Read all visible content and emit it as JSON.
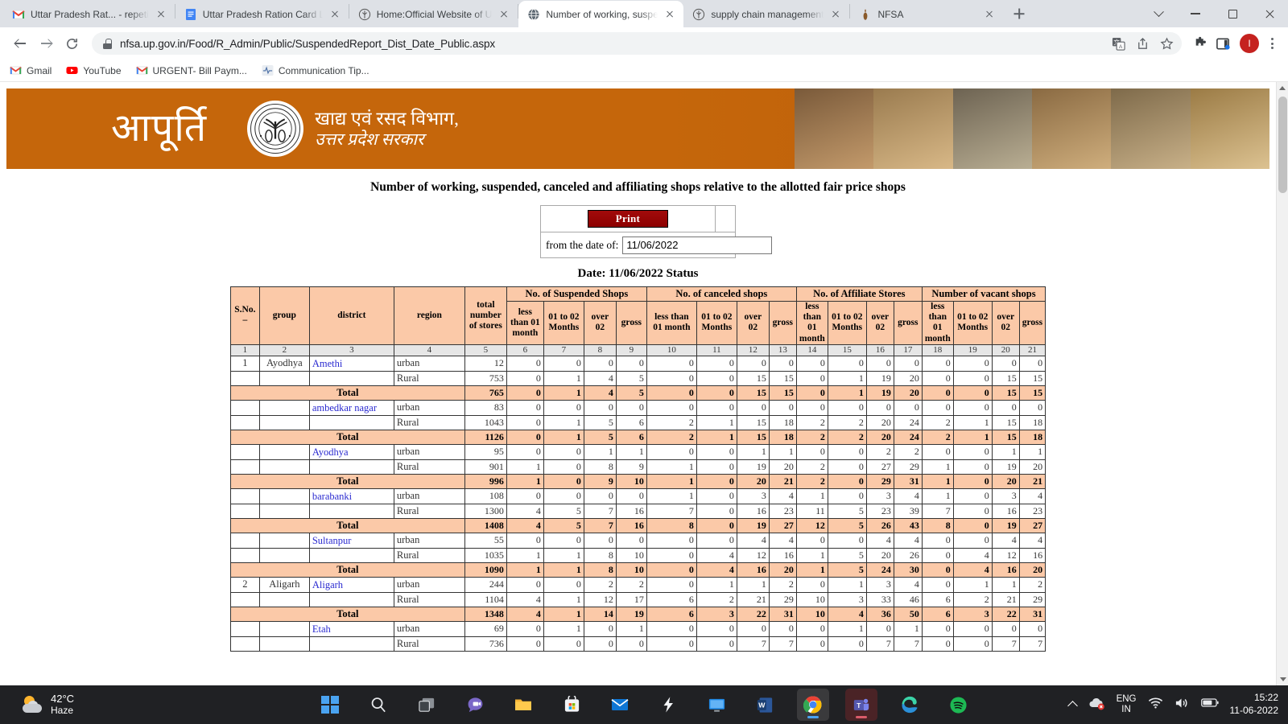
{
  "browser": {
    "tabs": [
      {
        "title": "Uttar Pradesh Rat... - repeti",
        "favicon": "gmail-icon",
        "active": false
      },
      {
        "title": "Uttar Pradesh Ration Card L",
        "favicon": "docs-icon",
        "active": false
      },
      {
        "title": "Home:Official Website of U",
        "favicon": "emblem-icon",
        "active": false
      },
      {
        "title": "Number of working, susper",
        "favicon": "globe-icon",
        "active": true
      },
      {
        "title": "supply chain management",
        "favicon": "emblem-icon",
        "active": false
      },
      {
        "title": "NFSA",
        "favicon": "emblem-icon",
        "active": false
      }
    ],
    "address": "nfsa.up.gov.in/Food/R_Admin/Public/SuspendedReport_Dist_Date_Public.aspx",
    "profile_initial": "I",
    "bookmarks": [
      {
        "label": "Gmail",
        "icon": "gmail-icon"
      },
      {
        "label": "YouTube",
        "icon": "youtube-icon"
      },
      {
        "label": "URGENT- Bill Paym...",
        "icon": "gmail-icon"
      },
      {
        "label": "Communication Tip...",
        "icon": "pulse-icon"
      }
    ]
  },
  "banner": {
    "brand": "आपूर्ति",
    "dept_line1": "खाद्य एवं रसद विभाग,",
    "dept_line2": "उत्तर प्रदेश सरकार"
  },
  "page": {
    "title": "Number of working, suspended, canceled and affiliating shops relative to the allotted fair price shops",
    "print_label": "Print",
    "date_field_label": "from the date of:",
    "date_value": "11/06/2022",
    "status_line": "Date: 11/06/2022 Status"
  },
  "table": {
    "group_headers": [
      {
        "label": "No. of Suspended Shops",
        "span": 4
      },
      {
        "label": "No. of canceled shops",
        "span": 4
      },
      {
        "label": "No. of Affiliate Stores",
        "span": 4
      },
      {
        "label": "Number of vacant shops",
        "span": 4
      }
    ],
    "lead_headers": [
      "S.No.\n–",
      "group",
      "district",
      "region",
      "total number of stores"
    ],
    "sub_headers": [
      "less than 01 month",
      "01 to 02 Months",
      "over 02",
      "gross"
    ],
    "column_numbers": [
      "1",
      "2",
      "3",
      "4",
      "5",
      "6",
      "7",
      "8",
      "9",
      "10",
      "11",
      "12",
      "13",
      "14",
      "15",
      "16",
      "17",
      "18",
      "19",
      "20",
      "21"
    ],
    "rows": [
      {
        "type": "data",
        "sno": "1",
        "group": "Ayodhya",
        "district": "Amethi",
        "region": "urban",
        "values": [
          12,
          0,
          0,
          0,
          0,
          0,
          0,
          0,
          0,
          0,
          0,
          0,
          0,
          0,
          0,
          0,
          0
        ]
      },
      {
        "type": "data",
        "sno": "",
        "group": "",
        "district": "",
        "region": "Rural",
        "values": [
          753,
          0,
          1,
          4,
          5,
          0,
          0,
          15,
          15,
          0,
          1,
          19,
          20,
          0,
          0,
          15,
          15
        ]
      },
      {
        "type": "total",
        "label": "Total",
        "values": [
          765,
          0,
          1,
          4,
          5,
          0,
          0,
          15,
          15,
          0,
          1,
          19,
          20,
          0,
          0,
          15,
          15
        ]
      },
      {
        "type": "data",
        "sno": "",
        "group": "",
        "district": "ambedkar nagar",
        "region": "urban",
        "values": [
          83,
          0,
          0,
          0,
          0,
          0,
          0,
          0,
          0,
          0,
          0,
          0,
          0,
          0,
          0,
          0,
          0
        ]
      },
      {
        "type": "data",
        "sno": "",
        "group": "",
        "district": "",
        "region": "Rural",
        "values": [
          1043,
          0,
          1,
          5,
          6,
          2,
          1,
          15,
          18,
          2,
          2,
          20,
          24,
          2,
          1,
          15,
          18
        ]
      },
      {
        "type": "total",
        "label": "Total",
        "values": [
          1126,
          0,
          1,
          5,
          6,
          2,
          1,
          15,
          18,
          2,
          2,
          20,
          24,
          2,
          1,
          15,
          18
        ]
      },
      {
        "type": "data",
        "sno": "",
        "group": "",
        "district": "Ayodhya",
        "region": "urban",
        "values": [
          95,
          0,
          0,
          1,
          1,
          0,
          0,
          1,
          1,
          0,
          0,
          2,
          2,
          0,
          0,
          1,
          1
        ]
      },
      {
        "type": "data",
        "sno": "",
        "group": "",
        "district": "",
        "region": "Rural",
        "values": [
          901,
          1,
          0,
          8,
          9,
          1,
          0,
          19,
          20,
          2,
          0,
          27,
          29,
          1,
          0,
          19,
          20
        ]
      },
      {
        "type": "total",
        "label": "Total",
        "values": [
          996,
          1,
          0,
          9,
          10,
          1,
          0,
          20,
          21,
          2,
          0,
          29,
          31,
          1,
          0,
          20,
          21
        ]
      },
      {
        "type": "data",
        "sno": "",
        "group": "",
        "district": "barabanki",
        "region": "urban",
        "values": [
          108,
          0,
          0,
          0,
          0,
          1,
          0,
          3,
          4,
          1,
          0,
          3,
          4,
          1,
          0,
          3,
          4
        ]
      },
      {
        "type": "data",
        "sno": "",
        "group": "",
        "district": "",
        "region": "Rural",
        "values": [
          1300,
          4,
          5,
          7,
          16,
          7,
          0,
          16,
          23,
          11,
          5,
          23,
          39,
          7,
          0,
          16,
          23
        ]
      },
      {
        "type": "total",
        "label": "Total",
        "values": [
          1408,
          4,
          5,
          7,
          16,
          8,
          0,
          19,
          27,
          12,
          5,
          26,
          43,
          8,
          0,
          19,
          27
        ]
      },
      {
        "type": "data",
        "sno": "",
        "group": "",
        "district": "Sultanpur",
        "region": "urban",
        "values": [
          55,
          0,
          0,
          0,
          0,
          0,
          0,
          4,
          4,
          0,
          0,
          4,
          4,
          0,
          0,
          4,
          4
        ]
      },
      {
        "type": "data",
        "sno": "",
        "group": "",
        "district": "",
        "region": "Rural",
        "values": [
          1035,
          1,
          1,
          8,
          10,
          0,
          4,
          12,
          16,
          1,
          5,
          20,
          26,
          0,
          4,
          12,
          16
        ]
      },
      {
        "type": "total",
        "label": "Total",
        "values": [
          1090,
          1,
          1,
          8,
          10,
          0,
          4,
          16,
          20,
          1,
          5,
          24,
          30,
          0,
          4,
          16,
          20
        ]
      },
      {
        "type": "data",
        "sno": "2",
        "group": "Aligarh",
        "district": "Aligarh",
        "region": "urban",
        "values": [
          244,
          0,
          0,
          2,
          2,
          0,
          1,
          1,
          2,
          0,
          1,
          3,
          4,
          0,
          1,
          1,
          2
        ]
      },
      {
        "type": "data",
        "sno": "",
        "group": "",
        "district": "",
        "region": "Rural",
        "values": [
          1104,
          4,
          1,
          12,
          17,
          6,
          2,
          21,
          29,
          10,
          3,
          33,
          46,
          6,
          2,
          21,
          29
        ]
      },
      {
        "type": "total",
        "label": "Total",
        "values": [
          1348,
          4,
          1,
          14,
          19,
          6,
          3,
          22,
          31,
          10,
          4,
          36,
          50,
          6,
          3,
          22,
          31
        ]
      },
      {
        "type": "data",
        "sno": "",
        "group": "",
        "district": "Etah",
        "region": "urban",
        "values": [
          69,
          0,
          1,
          0,
          1,
          0,
          0,
          0,
          0,
          0,
          1,
          0,
          1,
          0,
          0,
          0,
          0
        ]
      },
      {
        "type": "data",
        "sno": "",
        "group": "",
        "district": "",
        "region": "Rural",
        "values": [
          736,
          0,
          0,
          0,
          0,
          0,
          0,
          7,
          7,
          0,
          0,
          7,
          7,
          0,
          0,
          7,
          7
        ]
      }
    ]
  },
  "taskbar": {
    "weather_temp": "42°C",
    "weather_cond": "Haze",
    "apps": [
      {
        "name": "start-windows-icon"
      },
      {
        "name": "search-icon"
      },
      {
        "name": "task-view-icon"
      },
      {
        "name": "teams-chat-icon"
      },
      {
        "name": "file-explorer-icon"
      },
      {
        "name": "microsoft-store-icon"
      },
      {
        "name": "mail-icon"
      },
      {
        "name": "shareit-icon"
      },
      {
        "name": "remote-desktop-icon"
      },
      {
        "name": "word-icon"
      },
      {
        "name": "chrome-icon"
      },
      {
        "name": "teams-icon"
      },
      {
        "name": "edge-icon"
      },
      {
        "name": "spotify-icon"
      }
    ],
    "language": "ENG",
    "language_sub": "IN",
    "time": "15:22",
    "date": "11-06-2022"
  },
  "colors": {
    "banner_orange": "#c5660b",
    "header_peach": "#fbc9a8",
    "print_red": "#8c0000",
    "link_blue": "#2a2ad0"
  }
}
